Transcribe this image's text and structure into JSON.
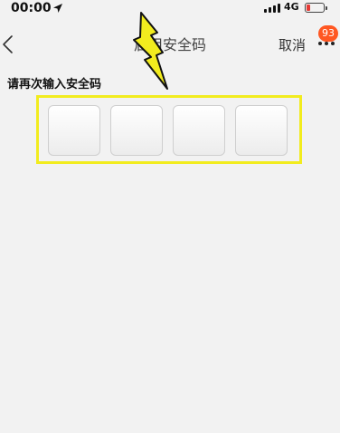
{
  "status_bar": {
    "time": "00:00",
    "network": "4G"
  },
  "nav": {
    "title": "启用安全码",
    "cancel_label": "取消",
    "badge_count": "93"
  },
  "prompt": "请再次输入安全码",
  "code": {
    "length": 4,
    "values": [
      "",
      "",
      "",
      ""
    ]
  },
  "colors": {
    "highlight": "#f2ec1e",
    "badge": "#ff5722",
    "battery_low": "#e53935"
  }
}
